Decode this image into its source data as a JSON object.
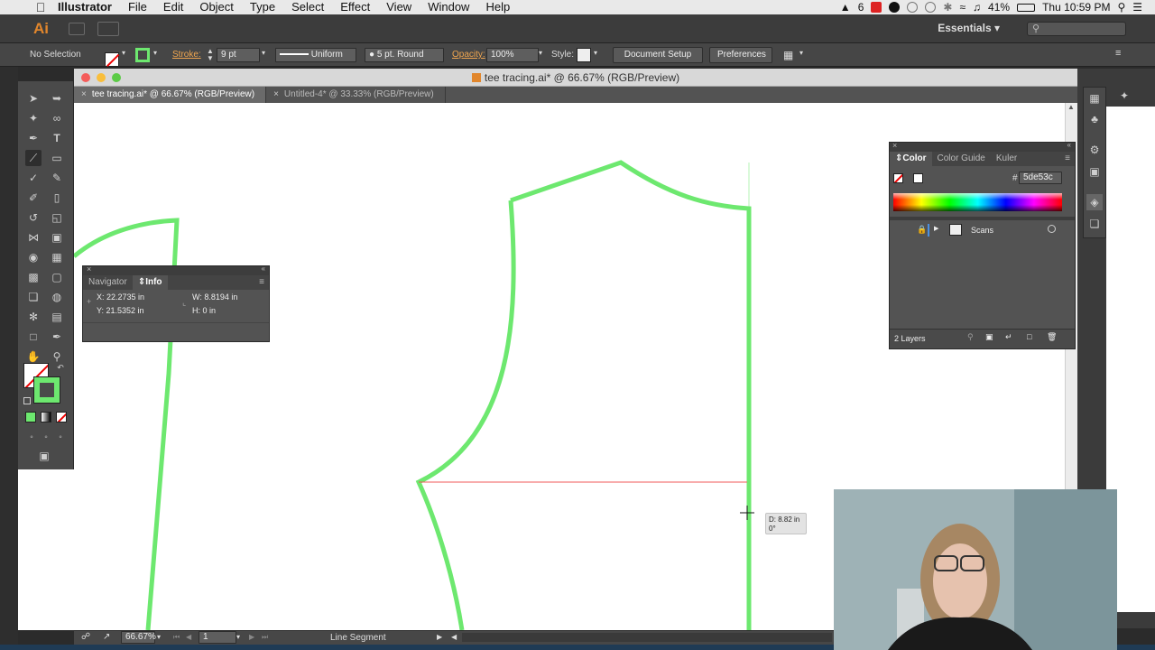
{
  "menubar": {
    "app": "Illustrator",
    "items": [
      "File",
      "Edit",
      "Object",
      "Type",
      "Select",
      "Effect",
      "View",
      "Window",
      "Help"
    ],
    "status": {
      "adobe_count": "6",
      "battery": "41%",
      "clock": "Thu 10:59 PM"
    }
  },
  "appbar": {
    "logo": "Ai",
    "workspace": "Essentials"
  },
  "control": {
    "selection": "No Selection",
    "stroke_label": "Stroke:",
    "stroke_weight": "9 pt",
    "profile": "Uniform",
    "brush": "5 pt. Round",
    "opacity_label": "Opacity:",
    "opacity": "100%",
    "style_label": "Style:",
    "document_setup": "Document Setup",
    "preferences": "Preferences"
  },
  "document": {
    "window_title": "tee tracing.ai* @ 66.67% (RGB/Preview)",
    "tabs": [
      {
        "label": "tee tracing.ai* @ 66.67% (RGB/Preview)"
      },
      {
        "label": "Untitled-4* @ 33.33% (RGB/Preview)"
      }
    ]
  },
  "info_panel": {
    "tabs": [
      "Navigator",
      "Info"
    ],
    "x": "X:  22.2735 in",
    "y": "Y:  21.5352 in",
    "w": "W:  8.8194 in",
    "h": "H:  0 in"
  },
  "color_panel": {
    "tabs": [
      "Color",
      "Color Guide",
      "Kuler"
    ],
    "hex_label": "#",
    "hex": "5de53c",
    "layer_name": "Scans",
    "layer_count": "2 Layers"
  },
  "canvas": {
    "tooltip_distance": "D: 8.82 in",
    "tooltip_angle": "0°",
    "stroke_color": "#6de86f",
    "guide_color": "#f25a5a"
  },
  "statusbar": {
    "zoom": "66.67%",
    "page": "1",
    "tool": "Line Segment"
  }
}
